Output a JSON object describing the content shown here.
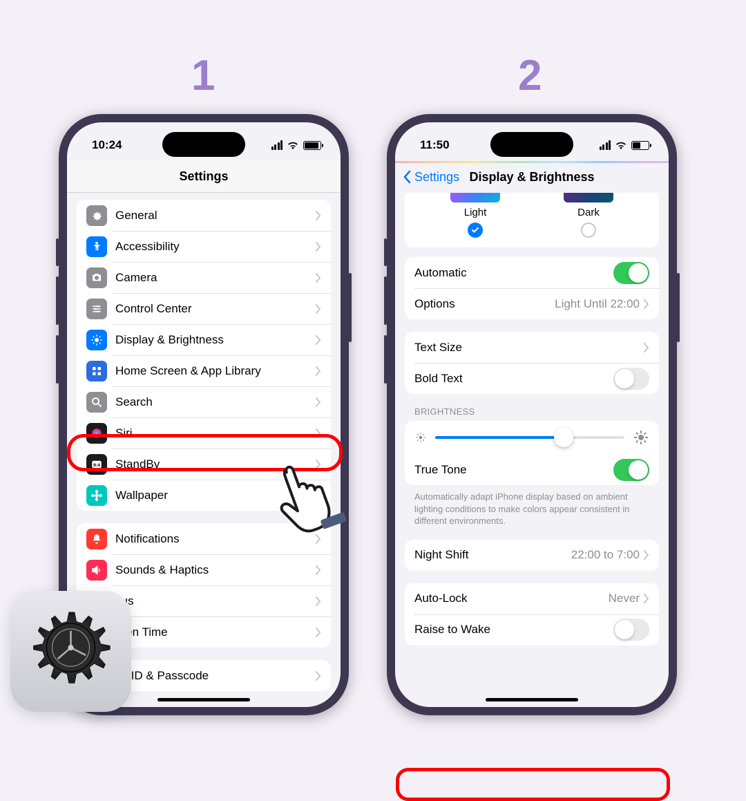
{
  "steps": {
    "one": "1",
    "two": "2"
  },
  "phone1": {
    "time": "10:24",
    "title": "Settings",
    "items": [
      {
        "label": "General",
        "icon": "gear",
        "color": "#8e8e93"
      },
      {
        "label": "Accessibility",
        "icon": "figure",
        "color": "#007aff"
      },
      {
        "label": "Camera",
        "icon": "camera",
        "color": "#8e8e93"
      },
      {
        "label": "Control Center",
        "icon": "switches",
        "color": "#8e8e93"
      },
      {
        "label": "Display & Brightness",
        "icon": "sun",
        "color": "#007aff"
      },
      {
        "label": "Home Screen & App Library",
        "icon": "grid",
        "color": "#2b6de0"
      },
      {
        "label": "Search",
        "icon": "search",
        "color": "#8e8e93"
      },
      {
        "label": "Siri",
        "icon": "siri",
        "color": "#1c1c1e"
      },
      {
        "label": "StandBy",
        "icon": "clock",
        "color": "#1c1c1e"
      },
      {
        "label": "Wallpaper",
        "icon": "flower",
        "color": "#00c7be"
      }
    ],
    "items2": [
      {
        "label": "Notifications",
        "icon": "bell",
        "color": "#ff3b30"
      },
      {
        "label": "Sounds & Haptics",
        "icon": "speaker",
        "color": "#ff2d55"
      },
      {
        "label": "Focus",
        "icon": "moon",
        "color": "#5856d6",
        "truncated": "cus"
      },
      {
        "label": "Screen Time",
        "icon": "hourglass",
        "color": "#5856d6",
        "truncated": "reen Time"
      }
    ],
    "items3_first": "ce ID & Passcode"
  },
  "phone2": {
    "time": "11:50",
    "back": "Settings",
    "title": "Display & Brightness",
    "appearance": {
      "light": "Light",
      "dark": "Dark"
    },
    "automatic": "Automatic",
    "options": "Options",
    "options_detail": "Light Until 22:00",
    "text_size": "Text Size",
    "bold_text": "Bold Text",
    "brightness_hdr": "BRIGHTNESS",
    "true_tone": "True Tone",
    "true_tone_desc": "Automatically adapt iPhone display based on ambient lighting conditions to make colors appear consistent in different environments.",
    "night_shift": "Night Shift",
    "night_shift_detail": "22:00 to 7:00",
    "auto_lock": "Auto-Lock",
    "auto_lock_detail": "Never",
    "raise_to_wake": "Raise to Wake"
  }
}
